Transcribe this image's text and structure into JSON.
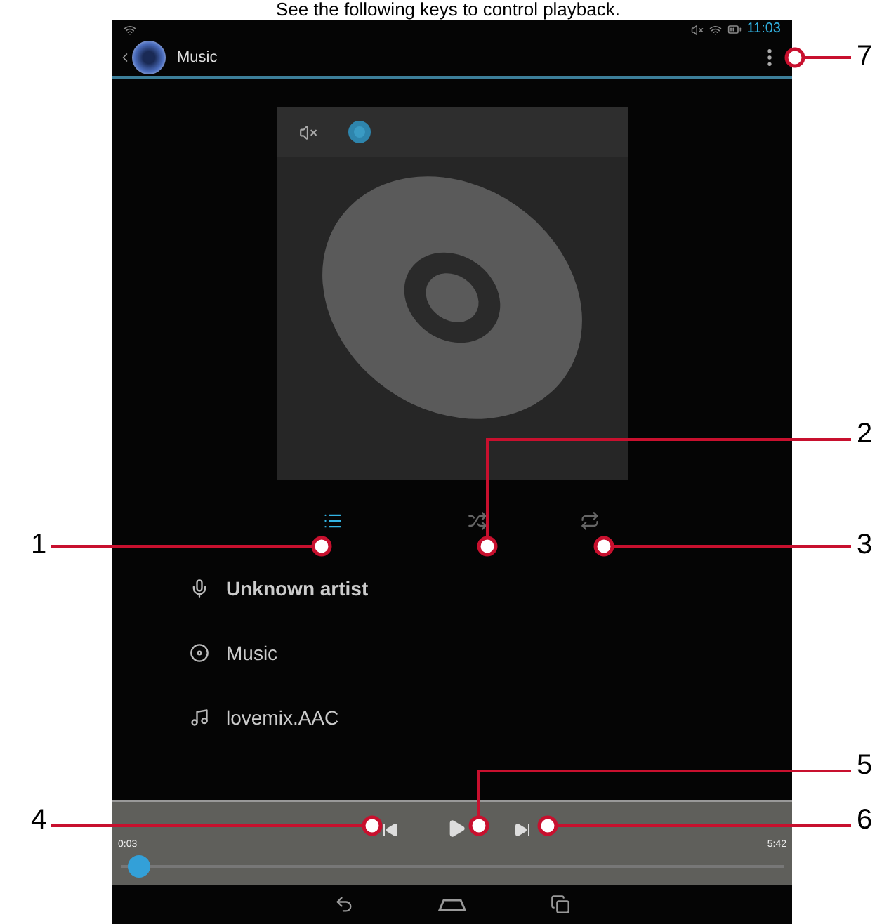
{
  "caption": "See the following keys to control playback.",
  "status_bar": {
    "time": "11:03"
  },
  "action_bar": {
    "title": "Music"
  },
  "controls": [
    {
      "kind": "playlist",
      "on": true
    },
    {
      "kind": "shuffle",
      "on": false
    },
    {
      "kind": "repeat",
      "on": false
    }
  ],
  "track_info": [
    {
      "kind": "artist",
      "text": "Unknown artist"
    },
    {
      "kind": "album",
      "text": "Music"
    },
    {
      "kind": "file",
      "text": "lovemix.AAC"
    }
  ],
  "player": {
    "elapsed": "0:03",
    "duration": "5:42",
    "level": 0.01
  },
  "callouts": [
    {
      "label": "7"
    },
    {
      "label": "2"
    },
    {
      "label": "1"
    },
    {
      "label": "3"
    },
    {
      "label": "5"
    },
    {
      "label": "4"
    },
    {
      "label": "6"
    }
  ]
}
